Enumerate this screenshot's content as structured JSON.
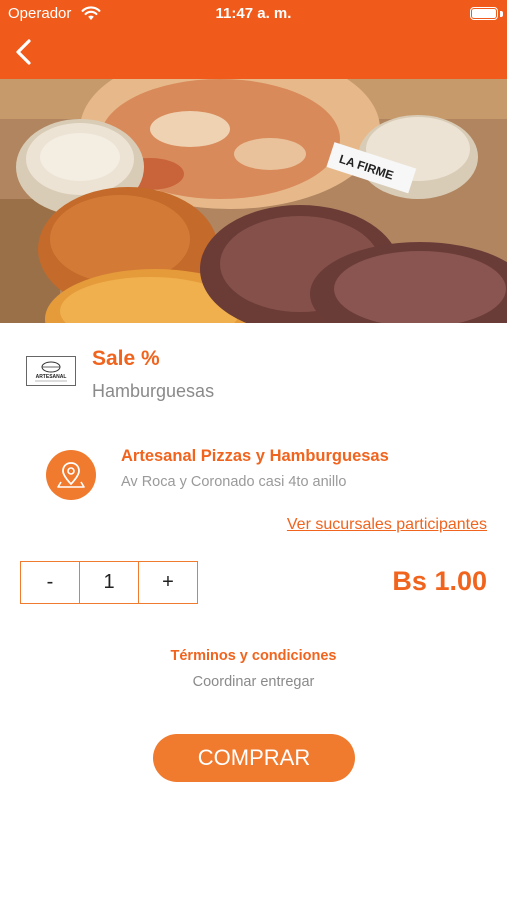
{
  "status_bar": {
    "carrier": "Operador",
    "time": "11:47 a. m."
  },
  "header": {
    "back_icon": "chevron-left-icon",
    "accent_color": "#f05a1a"
  },
  "hero": {
    "label_text": "LA FIRME"
  },
  "product": {
    "brand_logo_text": "ARTESANAL",
    "name": "Sale %",
    "category": "Hamburguesas"
  },
  "store": {
    "icon": "location-pin-icon",
    "name": "Artesanal Pizzas y Hamburguesas",
    "address": "Av Roca y Coronado casi 4to anillo",
    "branches_link": "Ver sucursales participantes"
  },
  "quantity": {
    "decrement_label": "-",
    "value": "1",
    "increment_label": "+"
  },
  "price": "Bs 1.00",
  "terms": {
    "title": "Términos y condiciones",
    "text": "Coordinar entregar"
  },
  "buy_button_label": "COMPRAR"
}
